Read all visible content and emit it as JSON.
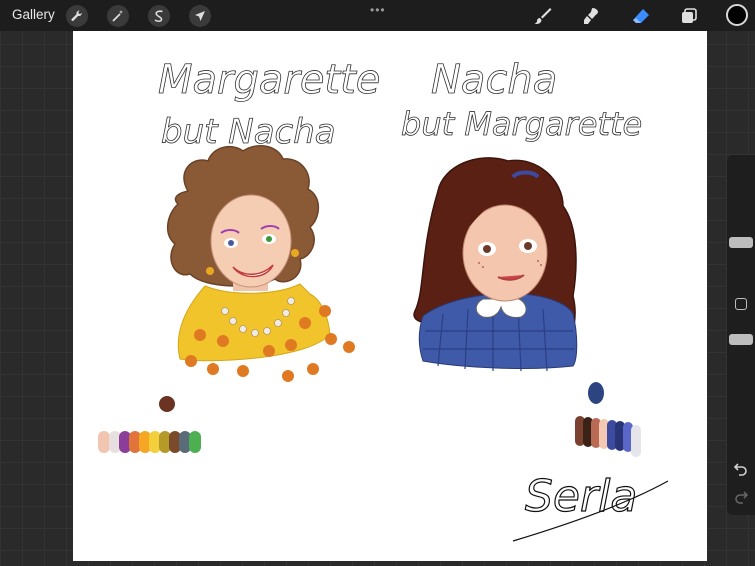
{
  "toolbar": {
    "gallery_label": "Gallery",
    "left_tools": [
      "wrench-icon",
      "magic-wand-icon",
      "selection-icon",
      "transform-arrow-icon"
    ],
    "more_dots": "•••",
    "right_tools": [
      "brush-icon",
      "smudge-icon",
      "eraser-icon",
      "layers-icon"
    ],
    "active_tool": "eraser-icon",
    "active_color": "#000000",
    "accent_color": "#3b8cff"
  },
  "sidebar": {
    "controls": [
      "brush-size-slider",
      "modify-button",
      "opacity-slider",
      "undo-icon",
      "redo-icon"
    ]
  },
  "canvas_text": {
    "line1_left": "Margarette",
    "line2_left": "but Nacha",
    "line1_right": "Nacha",
    "line2_right": "but Margarette",
    "signature": "Serla"
  },
  "palettes": {
    "left": [
      "#f2c5b0",
      "#e8e0e0",
      "#8b3d99",
      "#e0743a",
      "#f5a623",
      "#f3d03b",
      "#b59a2a",
      "#7a4a2b",
      "#5a6c7a",
      "#4caf50"
    ],
    "left_extra": "#6b3322",
    "right": [
      "#7a4030",
      "#3b2216",
      "#b86a55",
      "#f3c9b3",
      "#3c4aa0",
      "#2a3578",
      "#5a66c8",
      "#e6e6ea"
    ],
    "right_extra": "#2c4580"
  }
}
